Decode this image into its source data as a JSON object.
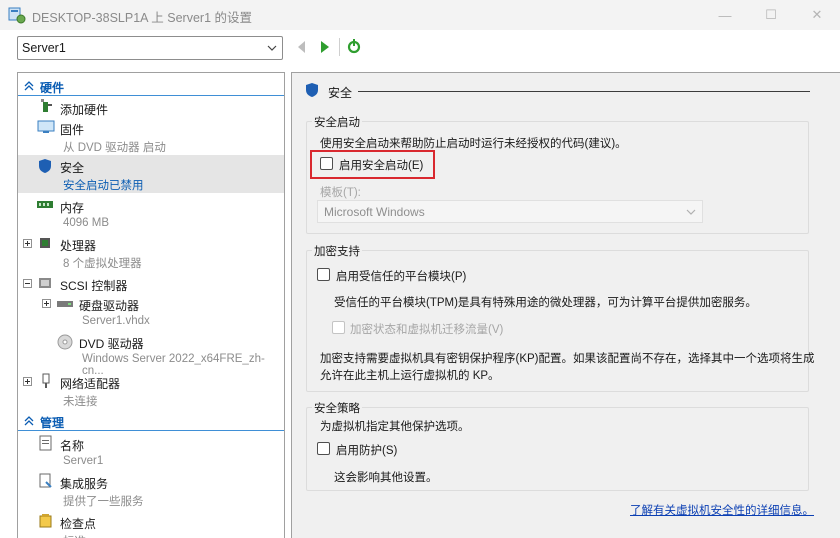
{
  "window": {
    "title": "DESKTOP-38SLP1A 上 Server1 的设置",
    "minimize": "—",
    "maximize": "☐",
    "close": "✕"
  },
  "toolbar": {
    "vm_selected": "Server1"
  },
  "sidebar": {
    "hardware_label": "硬件",
    "management_label": "管理",
    "items": {
      "add_hardware": {
        "name": "添加硬件"
      },
      "firmware": {
        "name": "固件",
        "sub": "从 DVD 驱动器 启动"
      },
      "security": {
        "name": "安全",
        "sub": "安全启动已禁用"
      },
      "memory": {
        "name": "内存",
        "sub": "4096 MB"
      },
      "processor": {
        "name": "处理器",
        "sub": "8 个虚拟处理器"
      },
      "scsi": {
        "name": "SCSI 控制器"
      },
      "hard_drive": {
        "name": "硬盘驱动器",
        "sub": "Server1.vhdx"
      },
      "dvd_drive": {
        "name": "DVD 驱动器",
        "sub": "Windows Server 2022_x64FRE_zh-cn..."
      },
      "network": {
        "name": "网络适配器",
        "sub": "未连接"
      },
      "name": {
        "name": "名称",
        "sub": "Server1"
      },
      "integration": {
        "name": "集成服务",
        "sub": "提供了一些服务"
      },
      "checkpoints": {
        "name": "检查点",
        "sub": "标准"
      }
    }
  },
  "main": {
    "header_title": "安全",
    "secure_boot": {
      "title": "安全启动",
      "description": "使用安全启动来帮助防止启动时运行未经授权的代码(建议)。",
      "enable_label": "启用安全启动(E)",
      "template_label": "模板(T):",
      "template_value": "Microsoft Windows"
    },
    "encryption": {
      "title": "加密支持",
      "tpm_label": "启用受信任的平台模块(P)",
      "tpm_description": "受信任的平台模块(TPM)是具有特殊用途的微处理器，可为计算平台提供加密服务。",
      "encrypt_label": "加密状态和虚拟机迁移流量(V)",
      "kp_line1": "加密支持需要虚拟机具有密钥保护程序(KP)配置。如果该配置尚不存在，选择其中一个选项将生成",
      "kp_line2": "允许在此主机上运行虚拟机的 KP。"
    },
    "policy": {
      "title": "安全策略",
      "description": "为虚拟机指定其他保护选项。",
      "shield_label": "启用防护(S)",
      "shield_note": "这会影响其他设置。"
    },
    "learn_more": "了解有关虚拟机安全性的详细信息。"
  }
}
